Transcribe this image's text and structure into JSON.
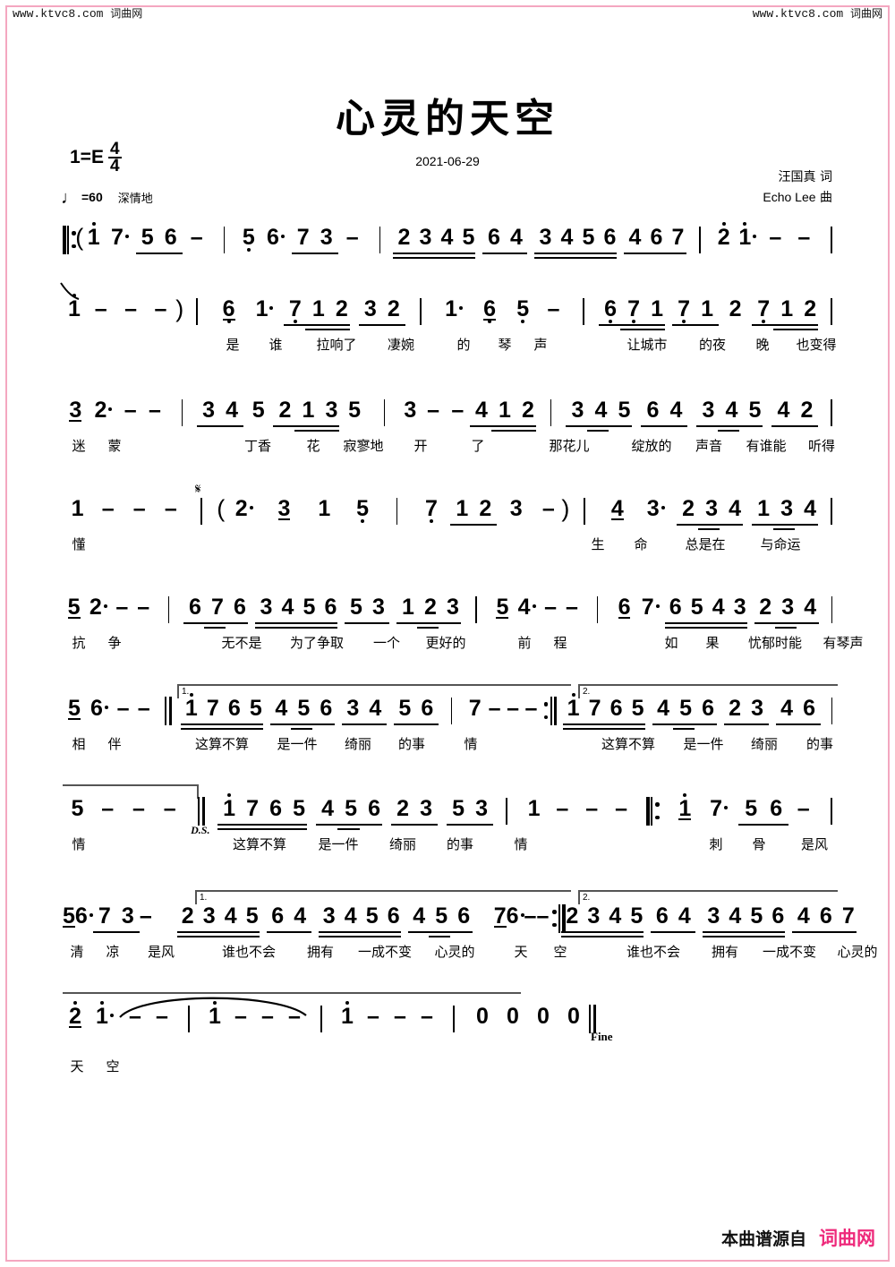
{
  "watermark": {
    "left": "www.ktvc8.com",
    "left_cn": "词曲网",
    "right": "www.ktvc8.com",
    "right_cn": "词曲网"
  },
  "header": {
    "title": "心灵的天空",
    "date": "2021-06-29",
    "key_label": "1=E",
    "time_num": "4",
    "time_den": "4",
    "tempo_note": "♩",
    "tempo_eq": "=60",
    "expression": "深情地",
    "lyricist": "汪国真 词",
    "composer_name": "Echo Lee",
    "composer_role": "曲"
  },
  "marks": {
    "segno": "𝄋",
    "ds": "D.S.",
    "fine": "Fine",
    "volta1": "1.",
    "volta2": "2."
  },
  "footer": {
    "text": "本曲谱源自",
    "brand": "词曲网"
  },
  "score": {
    "notation": "jianpu",
    "systems": [
      {
        "id": "system-1",
        "notes": "‖: ( 1̇ 7· 56 — | 5̣ 6· 73 — | 2345 64 3456 467 | 2̇ 1̇· — —  |",
        "lyrics": ""
      },
      {
        "id": "system-2",
        "notes": "1̇ — — — ) | 6̣ 1· 7̣12 32 | 1· 6̣ 5̣ — | 6̣7̣1 7̣1 2 7̣12 |",
        "lyrics": "是 谁 拉响了 凄婉 的 琴 声 让城市 的夜 晚 也变得"
      },
      {
        "id": "system-3",
        "notes": "32· — — | 345 2135 | 3 — — 412 | 345 64 345 42 |",
        "lyrics": "迷 蒙 丁香 花 寂寥地 开 了 那花儿 绽放的 声音 有谁能 听得"
      },
      {
        "id": "system-4",
        "notes": "1 — — — | ( 2· 3 1 5̣ | 7̣ 12 3 — ) | 4 3· 234 134 |",
        "lyrics": "懂 生 命 总是在 与命运"
      },
      {
        "id": "system-5",
        "notes": "52· — — | 676 3456 53 123 | 54· — — | 6 7· 6543 234 |",
        "lyrics": "抗 争 无不是 为了争取 一个 更好的 前 程 如 果 忧郁时能 有琴声"
      },
      {
        "id": "system-6",
        "notes": "56· — — ‖ [1.] 1̇765 456 34 56 | 7 — — — :‖ [2.] 1̇765 456 23 46 |",
        "lyrics": "相 伴 这算不算 是一件 绮丽 的事 情 这算不算 是一件 绮丽 的事"
      },
      {
        "id": "system-7",
        "notes": "5 — — — ‖ (D.S.) 1̇765 456 23 53 | 1 — — — ‖: 1̇ 7· 56 — |",
        "lyrics": "情 这算不算 是一件 绮丽 的事 情 刺 骨 是风"
      },
      {
        "id": "system-8",
        "notes": "56· 73 — [1.] 2345 64 3456 456 | 76· — — :‖ [2.] 2345 64 3456 467 |",
        "lyrics": "清 凉 是风 谁也不会 拥有 一成不变 心灵的 天 空 谁也不会 拥有 一成不变 心灵的"
      },
      {
        "id": "system-9",
        "notes": "2̇ 1̇· — — | 1̇ — — — | 1̇ — — — | 0 0 0 0 ‖ (Fine)",
        "lyrics": "天 空"
      }
    ]
  }
}
